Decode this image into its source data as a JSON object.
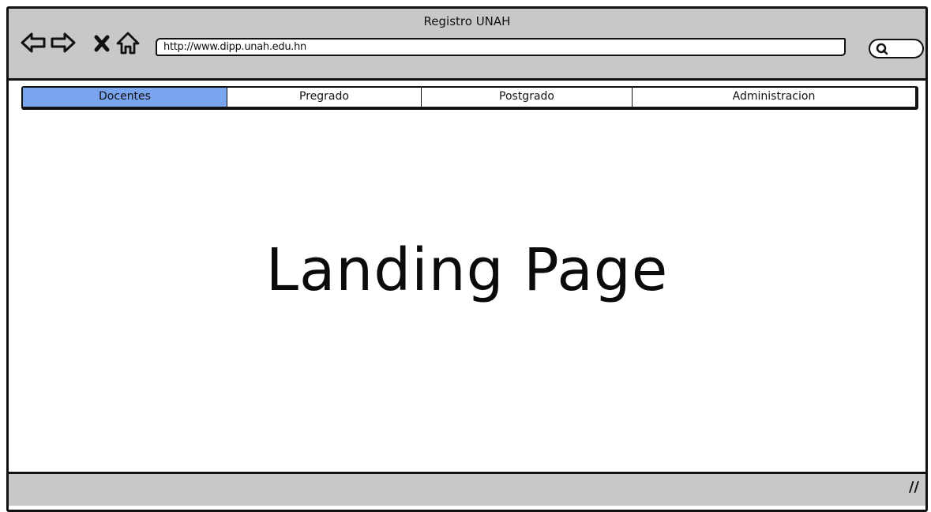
{
  "window": {
    "title": "Registro UNAH",
    "url": "http://www.dipp.unah.edu.hn"
  },
  "nav": {
    "back_icon": "back-arrow-icon",
    "forward_icon": "forward-arrow-icon",
    "stop_icon": "close-icon",
    "home_icon": "home-icon",
    "search_icon": "search-icon"
  },
  "tabs": [
    {
      "label": "Docentes",
      "active": true
    },
    {
      "label": "Pregrado",
      "active": false
    },
    {
      "label": "Postgrado",
      "active": false
    },
    {
      "label": "Administracion",
      "active": false
    }
  ],
  "main": {
    "heading": "Landing Page"
  },
  "colors": {
    "chrome": "#c8c8c8",
    "active_tab": "#7aa5ee",
    "border": "#111111"
  }
}
